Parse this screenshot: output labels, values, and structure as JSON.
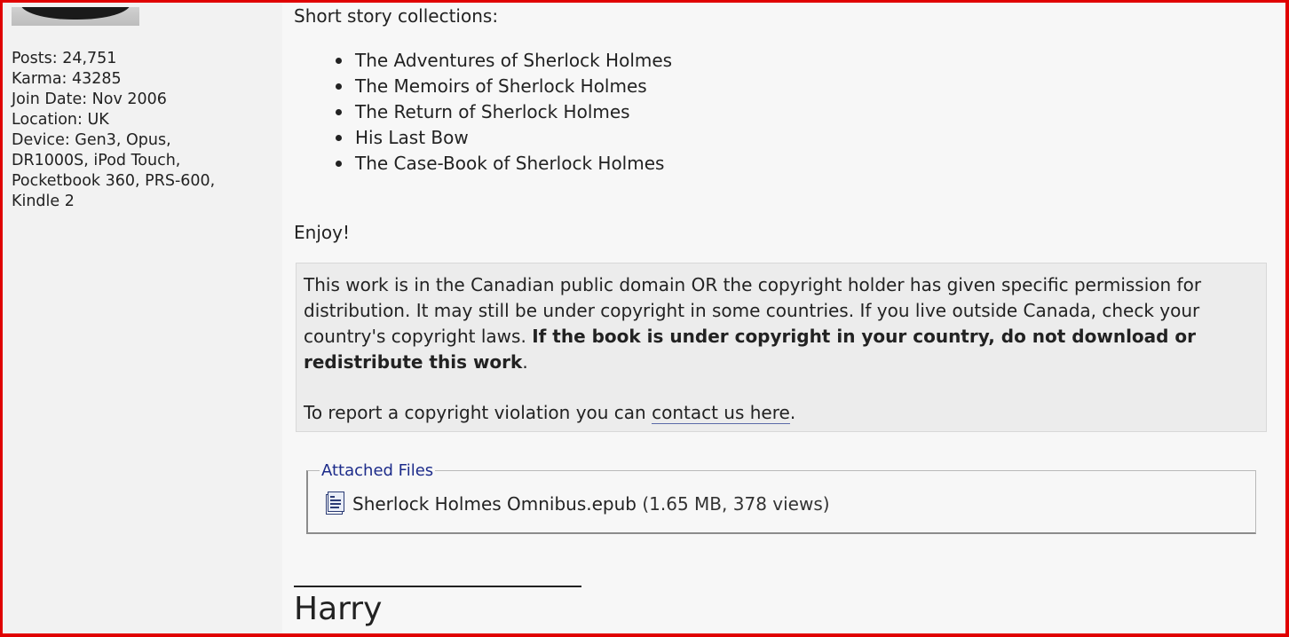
{
  "user": {
    "posts": "Posts: 24,751",
    "karma": "Karma: 43285",
    "join_date": "Join Date: Nov 2006",
    "location": "Location: UK",
    "device_lines": [
      "Device: Gen3, Opus,",
      "DR1000S, iPod Touch,",
      "Pocketbook 360, PRS-600,",
      "Kindle 2"
    ]
  },
  "post": {
    "heading": "Short story collections:",
    "collections": [
      "The Adventures of Sherlock Holmes",
      "The Memoirs of Sherlock Holmes",
      "The Return of Sherlock Holmes",
      "His Last Bow",
      "The Case-Book of Sherlock Holmes"
    ],
    "closing": "Enjoy!"
  },
  "notice": {
    "text_plain": "This work is in the Canadian public domain OR the copyright holder has given specific permission for distribution. It may still be under copyright in some countries. If you live outside Canada, check your country's copyright laws. ",
    "text_bold": "If the book is under copyright in your country, do not download or redistribute this work",
    "text_end": ".",
    "report_prefix": "To report a copyright violation you can ",
    "report_link": "contact us here",
    "report_suffix": "."
  },
  "attachments": {
    "legend": "Attached Files",
    "files": [
      {
        "name": "Sherlock Holmes Omnibus.epub",
        "meta": " (1.65 MB, 378 views)",
        "icon": "epub-file-icon"
      }
    ]
  },
  "signature": {
    "name": "Harry"
  },
  "colors": {
    "frame": "#e00000",
    "legend": "#1c2b8a",
    "link_underline": "#5b6aa8"
  }
}
